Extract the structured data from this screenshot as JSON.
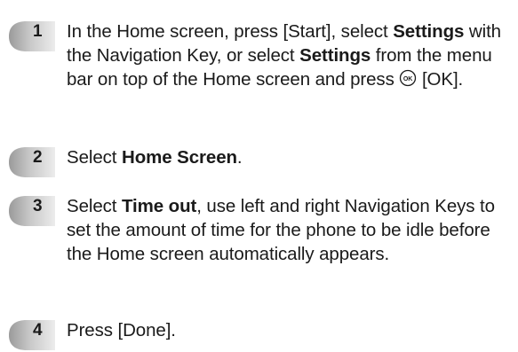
{
  "steps": [
    {
      "number": "1",
      "parts": [
        {
          "text": "In the Home screen, press [Start], select ",
          "bold": false
        },
        {
          "text": "Settings",
          "bold": true
        },
        {
          "text": " with the Navigation Key, or select ",
          "bold": false
        },
        {
          "text": "Settings",
          "bold": true
        },
        {
          "text": " from the menu bar on top of the Home screen and press ",
          "bold": false
        },
        {
          "icon": "ok-key-icon"
        },
        {
          "text": " [OK].",
          "bold": false
        }
      ]
    },
    {
      "number": "2",
      "parts": [
        {
          "text": "Select ",
          "bold": false
        },
        {
          "text": "Home Screen",
          "bold": true
        },
        {
          "text": ".",
          "bold": false
        }
      ]
    },
    {
      "number": "3",
      "parts": [
        {
          "text": "Select ",
          "bold": false
        },
        {
          "text": "Time out",
          "bold": true
        },
        {
          "text": ", use left and right Navigation Keys to set the amount of time for the phone to be idle before the Home screen automatically appears.",
          "bold": false
        }
      ]
    },
    {
      "number": "4",
      "parts": [
        {
          "text": "Press [Done].",
          "bold": false
        }
      ]
    }
  ],
  "colors": {
    "badge_light": "#e6e6e6",
    "badge_dark": "#9a9a9a",
    "text": "#1a1a1a"
  }
}
